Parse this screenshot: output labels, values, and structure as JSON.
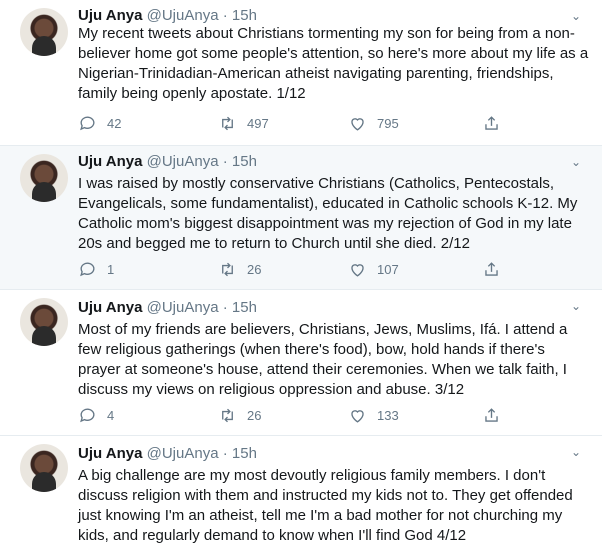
{
  "tweets": [
    {
      "name": "Uju Anya",
      "handle": "@UjuAnya",
      "separator": "·",
      "time": "15h",
      "text": "My recent tweets about Christians tormenting my son for being from a non-believer home got some people's attention, so here's more about my life as a Nigerian-Trinidadian-American atheist navigating parenting, friendships, family being openly apostate. 1/12",
      "replies": "42",
      "retweets": "497",
      "likes": "795"
    },
    {
      "name": "Uju Anya",
      "handle": "@UjuAnya",
      "separator": "·",
      "time": "15h",
      "text": "I was raised by mostly conservative Christians (Catholics, Pentecostals, Evangelicals, some fundamentalist), educated in Catholic schools K-12. My Catholic mom's biggest disappointment was my rejection of God in my late 20s and begged me to return to Church until she died. 2/12",
      "replies": "1",
      "retweets": "26",
      "likes": "107"
    },
    {
      "name": "Uju Anya",
      "handle": "@UjuAnya",
      "separator": "·",
      "time": "15h",
      "text": "Most of my friends are believers, Christians, Jews, Muslims, Ifá. I attend a few religious gatherings (when there's food), bow, hold hands if there's prayer at someone's house, attend their ceremonies. When we talk faith, I discuss my views on religious oppression and abuse. 3/12",
      "replies": "4",
      "retweets": "26",
      "likes": "133"
    },
    {
      "name": "Uju Anya",
      "handle": "@UjuAnya",
      "separator": "·",
      "time": "15h",
      "text": "A big challenge are my most devoutly religious family members. I don't discuss religion with them and instructed my kids not to. They get offended just knowing I'm an atheist, tell me I'm a bad mother for not churching my kids, and regularly demand to know when I'll find God 4/12"
    }
  ],
  "icons": {
    "reply": "reply-icon",
    "retweet": "retweet-icon",
    "like": "like-icon",
    "share": "share-icon",
    "menu": "chevron-down-icon"
  },
  "colors": {
    "highlight_background": "#f5f8fa",
    "muted_text": "#657786",
    "divider": "#e6ecf0"
  }
}
